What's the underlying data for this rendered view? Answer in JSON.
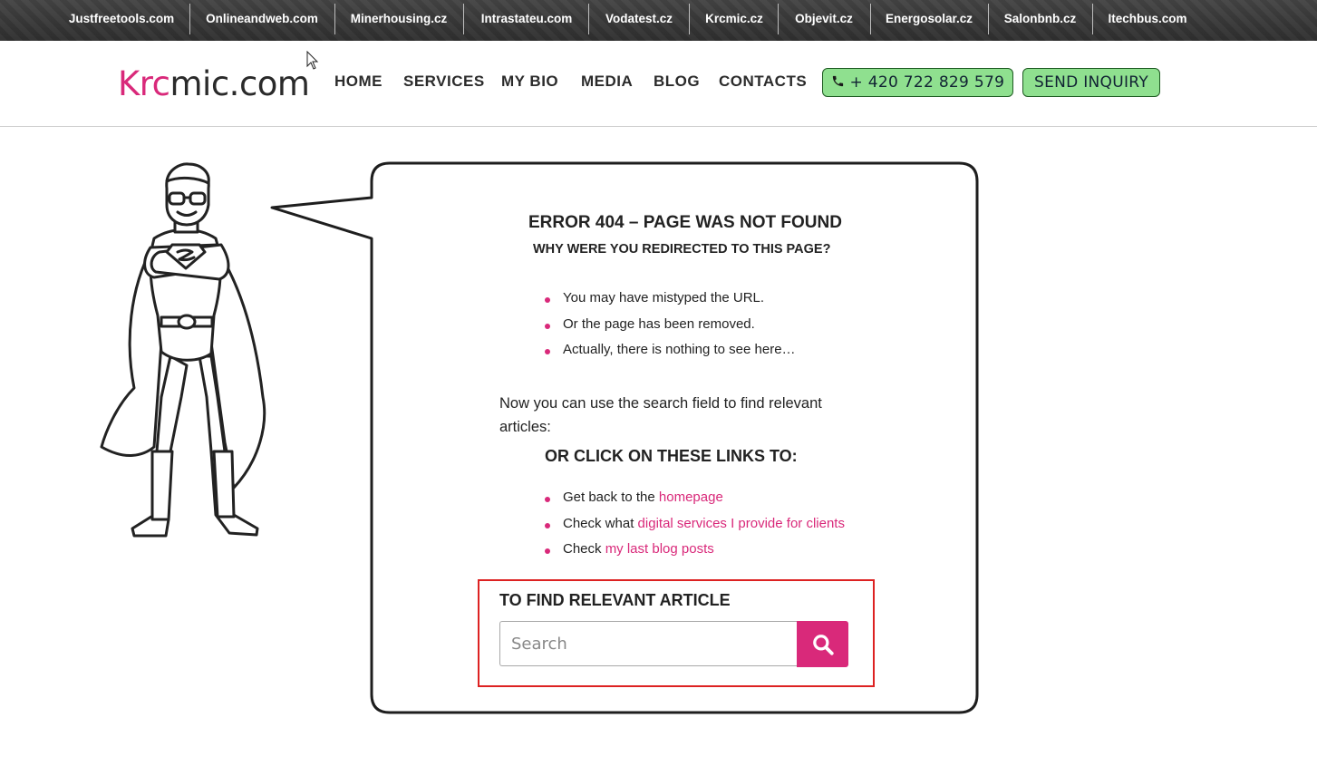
{
  "network": {
    "links": [
      "Justfreetools.com",
      "Onlineandweb.com",
      "Minerhousing.cz",
      "Intrastateu.com",
      "Vodatest.cz",
      "Krcmic.cz",
      "Objevit.cz",
      "Energosolar.cz",
      "Salonbnb.cz",
      "Itechbus.com"
    ]
  },
  "header": {
    "logo_part1": "Krc",
    "logo_part2": "mic.com",
    "nav": [
      "HOME",
      "SERVICES",
      "MY BIO",
      "MEDIA",
      "BLOG",
      "CONTACTS"
    ],
    "phone_label": "+ 420 722 829 579",
    "phone_icon": "phone-icon",
    "inquiry_label": "SEND INQUIRY"
  },
  "error": {
    "title": "ERROR 404 – PAGE WAS NOT FOUND",
    "subtitle": "WHY WERE YOU REDIRECTED TO THIS PAGE?",
    "reasons": [
      "You may have mistyped the URL.",
      "Or the page has been removed.",
      "Actually, there is nothing to see here…"
    ],
    "search_hint": "Now you can use the search field to find relevant articles:",
    "links_heading": "OR CLICK ON THESE LINKS TO:",
    "links": [
      {
        "prefix": "Get back to the ",
        "link": "homepage"
      },
      {
        "prefix": "Check what ",
        "link": "digital services I provide for clients"
      },
      {
        "prefix": "Check ",
        "link": "my last blog posts"
      }
    ]
  },
  "search": {
    "title": "TO FIND RELEVANT ARTICLE",
    "placeholder": "Search",
    "button_icon": "search-icon"
  },
  "colors": {
    "accent": "#d9297a",
    "button_green": "#8fe08f",
    "topbar": "#3a3a3a"
  }
}
